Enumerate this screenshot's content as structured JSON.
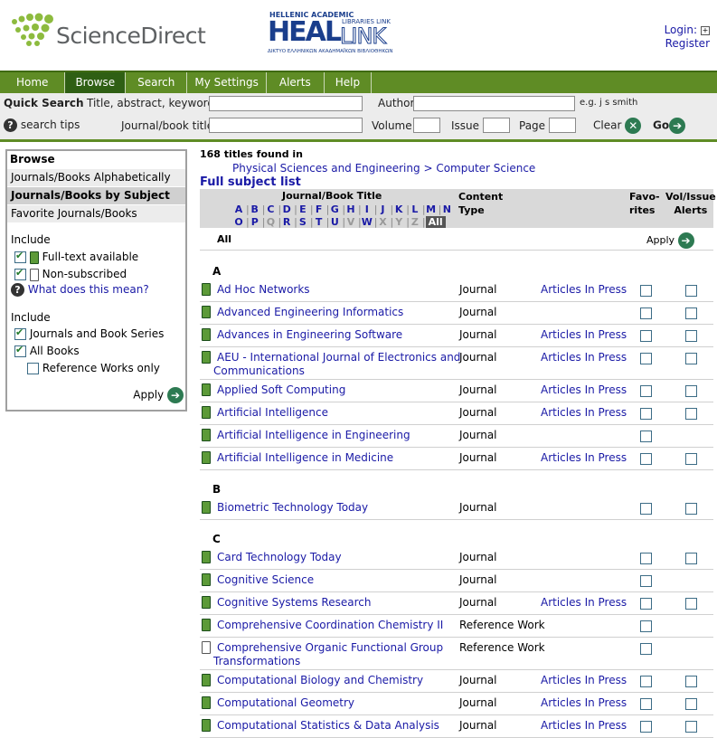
{
  "header": {
    "brand": "ScienceDirect",
    "heal_top": "HELLENIC ACADEMIC",
    "heal_sub": "LIBRARIES LINK",
    "heal_bottom": "ΔΙΚΤΥΟ ΕΛΛΗΝΙΚΩΝ ΑΚΑΔΗΜΑΪΚΩΝ ΒΙΒΛΙΟΘΗΚΩΝ",
    "login": "Login:",
    "register": "Register"
  },
  "nav": {
    "tabs": [
      "Home",
      "Browse",
      "Search",
      "My Settings",
      "Alerts",
      "Help"
    ],
    "active": "Browse"
  },
  "quick_search": {
    "title": "Quick Search",
    "tak_label": "Title, abstract, keywords",
    "author_label": "Author",
    "author_hint": "e.g. j s smith",
    "tips": "search tips",
    "journal_label": "Journal/book title",
    "volume_label": "Volume",
    "issue_label": "Issue",
    "page_label": "Page",
    "clear": "Clear",
    "go": "Go"
  },
  "sidebar": {
    "title": "Browse",
    "items": [
      "Journals/Books Alphabetically",
      "Journals/Books by Subject",
      "Favorite Journals/Books"
    ],
    "include1": "Include",
    "fulltext": "Full-text available",
    "nonsub": "Non-subscribed",
    "what": "What does this mean?",
    "include2": "Include",
    "series": "Journals and Book Series",
    "allbooks": "All Books",
    "refonly": "Reference Works only",
    "apply": "Apply"
  },
  "main": {
    "found": "168 titles found in",
    "path1": "Physical Sciences and Engineering",
    "sep": ">",
    "path2": "Computer Science",
    "full_list": "Full subject list",
    "col_title": "Journal/Book Title",
    "col_type1": "Content",
    "col_type2": "Type",
    "col_fav1": "Favo-",
    "col_fav2": "rites",
    "col_vol1": "Vol/Issue",
    "col_vol2": "Alerts",
    "letters1": [
      "A",
      "B",
      "C",
      "D",
      "E",
      "F",
      "G",
      "H",
      "I",
      "J",
      "K",
      "L",
      "M",
      "N"
    ],
    "letters2": [
      "O",
      "P",
      "Q",
      "R",
      "S",
      "T",
      "U",
      "V",
      "W",
      "X",
      "Y",
      "Z",
      "All"
    ],
    "all_label": "All",
    "apply": "Apply"
  },
  "groups": [
    {
      "letter": "A",
      "rows": [
        {
          "title": "Ad Hoc Networks",
          "type": "Journal",
          "aip": "Articles In Press",
          "vol": true
        },
        {
          "title": "Advanced Engineering Informatics",
          "type": "Journal",
          "aip": "",
          "vol": true
        },
        {
          "title": "Advances in Engineering Software",
          "type": "Journal",
          "aip": "Articles In Press",
          "vol": true
        },
        {
          "title": "AEU - International Journal of Electronics and",
          "title2": "Communications",
          "type": "Journal",
          "aip": "Articles In Press",
          "vol": true
        },
        {
          "title": "Applied Soft Computing",
          "type": "Journal",
          "aip": "Articles In Press",
          "vol": true
        },
        {
          "title": "Artificial Intelligence",
          "type": "Journal",
          "aip": "Articles In Press",
          "vol": true
        },
        {
          "title": "Artificial Intelligence in Engineering",
          "type": "Journal",
          "aip": "",
          "vol": false
        },
        {
          "title": "Artificial Intelligence in Medicine",
          "type": "Journal",
          "aip": "Articles In Press",
          "vol": true
        }
      ]
    },
    {
      "letter": "B",
      "rows": [
        {
          "title": "Biometric Technology Today",
          "type": "Journal",
          "aip": "",
          "vol": true
        }
      ]
    },
    {
      "letter": "C",
      "rows": [
        {
          "title": "Card Technology Today",
          "type": "Journal",
          "aip": "",
          "vol": true
        },
        {
          "title": "Cognitive Science",
          "type": "Journal",
          "aip": "",
          "vol": false
        },
        {
          "title": "Cognitive Systems Research",
          "type": "Journal",
          "aip": "Articles In Press",
          "vol": true
        },
        {
          "title": "Comprehensive Coordination Chemistry II",
          "type": "Reference Work",
          "aip": "",
          "vol": false
        },
        {
          "title": "Comprehensive Organic Functional Group",
          "title2": "Transformations",
          "type": "Reference Work",
          "aip": "",
          "vol": false,
          "nonsub": true
        },
        {
          "title": "Computational Biology and Chemistry",
          "type": "Journal",
          "aip": "Articles In Press",
          "vol": true
        },
        {
          "title": "Computational Geometry",
          "type": "Journal",
          "aip": "Articles In Press",
          "vol": true
        },
        {
          "title": "Computational Statistics & Data Analysis",
          "type": "Journal",
          "aip": "Articles In Press",
          "vol": true
        }
      ]
    }
  ]
}
